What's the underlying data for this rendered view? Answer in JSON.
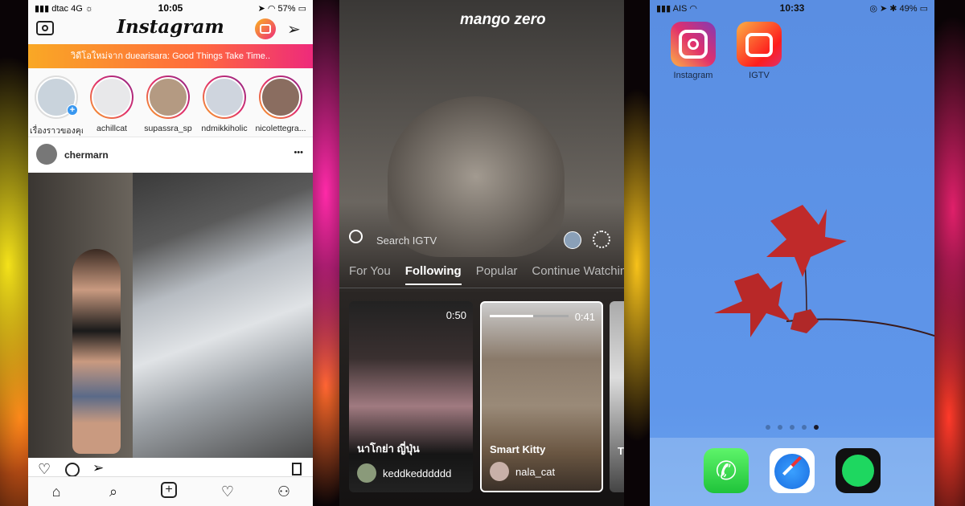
{
  "instagram": {
    "status": {
      "carrier": "dtac",
      "network": "4G",
      "time": "10:05",
      "battery": "57%"
    },
    "logo": "Instagram",
    "banner": "วิดีโอใหม่จาก duearisara: Good Things Take Time..",
    "stories": [
      {
        "name": "เรื่องราวของคุณ"
      },
      {
        "name": "achillcat"
      },
      {
        "name": "supassra_sp"
      },
      {
        "name": "ndmikkiholic"
      },
      {
        "name": "nicolettegra..."
      }
    ],
    "post": {
      "username": "chermarn",
      "more": "•••"
    },
    "colors": {
      "banner_start": "#f9a825",
      "banner_end": "#ee2a7b"
    }
  },
  "igtv": {
    "watermark": "mango zero",
    "search_placeholder": "Search IGTV",
    "tabs": [
      {
        "label": "For You"
      },
      {
        "label": "Following",
        "active": true
      },
      {
        "label": "Popular"
      },
      {
        "label": "Continue Watching"
      }
    ],
    "cards": [
      {
        "title": "นาโกย่า ญี่ปุ่น",
        "user": "keddkedddddd",
        "duration": "0:50"
      },
      {
        "title": "Smart Kitty",
        "user": "nala_cat",
        "duration": "0:41",
        "progress": 0.55,
        "selected": true
      },
      {
        "title": "T",
        "user": "",
        "duration": ""
      }
    ]
  },
  "homescreen": {
    "status": {
      "carrier": "AIS",
      "time": "10:33",
      "battery": "49%"
    },
    "apps": [
      {
        "label": "Instagram"
      },
      {
        "label": "IGTV"
      }
    ],
    "page_dots": 5,
    "active_page": 5,
    "dock": [
      {
        "name": "phone-icon"
      },
      {
        "name": "safari-icon"
      },
      {
        "name": "spotify-icon"
      }
    ]
  }
}
